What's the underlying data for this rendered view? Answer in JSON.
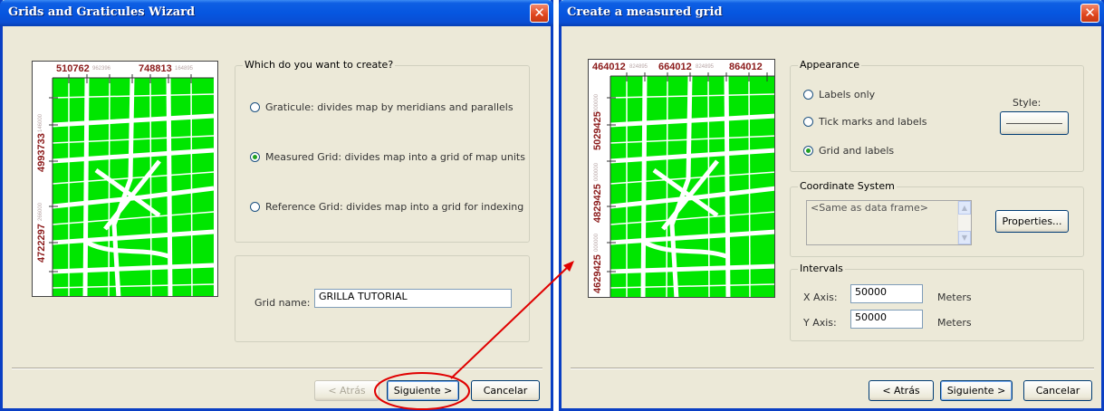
{
  "left_dialog": {
    "title": "Grids and Graticules Wizard",
    "close_glyph": "✕",
    "map": {
      "top_labels": [
        "510762",
        "748813"
      ],
      "top_small": [
        "962396",
        "164895"
      ],
      "side_labels": [
        "4993733",
        "4722297"
      ],
      "side_small": [
        "146000",
        "266000"
      ]
    },
    "question": "Which do you want to create?",
    "options": [
      {
        "label": "Graticule: divides map by meridians and parallels",
        "checked": false
      },
      {
        "label": "Measured Grid: divides map into a grid of map units",
        "checked": true
      },
      {
        "label": "Reference Grid: divides map into a grid for indexing",
        "checked": false
      }
    ],
    "grid_name_label": "Grid name:",
    "grid_name_value": "GRILLA TUTORIAL",
    "buttons": {
      "back": "< Atrás",
      "next": "Siguiente >",
      "cancel": "Cancelar"
    }
  },
  "right_dialog": {
    "title": "Create a measured grid",
    "close_glyph": "✕",
    "map": {
      "top_labels": [
        "464012",
        "664012",
        "864012"
      ],
      "top_small": [
        "824895",
        "824895"
      ],
      "side_labels": [
        "5029425",
        "4829425",
        "4629425"
      ],
      "side_small": [
        "000000",
        "000000",
        "000000"
      ]
    },
    "appearance": {
      "legend": "Appearance",
      "options": [
        {
          "label": "Labels only",
          "checked": false
        },
        {
          "label": "Tick marks and labels",
          "checked": false
        },
        {
          "label": "Grid and labels",
          "checked": true
        }
      ],
      "style_label": "Style:"
    },
    "coordinate_system": {
      "legend": "Coordinate System",
      "value": "<Same as data frame>",
      "properties_button": "Properties..."
    },
    "intervals": {
      "legend": "Intervals",
      "x_label": "X Axis:",
      "x_value": "50000",
      "x_unit": "Meters",
      "y_label": "Y Axis:",
      "y_value": "50000",
      "y_unit": "Meters"
    },
    "buttons": {
      "back": "< Atrás",
      "next": "Siguiente >",
      "cancel": "Cancelar"
    }
  },
  "colors": {
    "title_bar": "#0656e0",
    "dialog_bg": "#ece9d8",
    "map_fill": "#00e600",
    "label_red": "#8b1a1a",
    "annotation_red": "#e00000"
  }
}
